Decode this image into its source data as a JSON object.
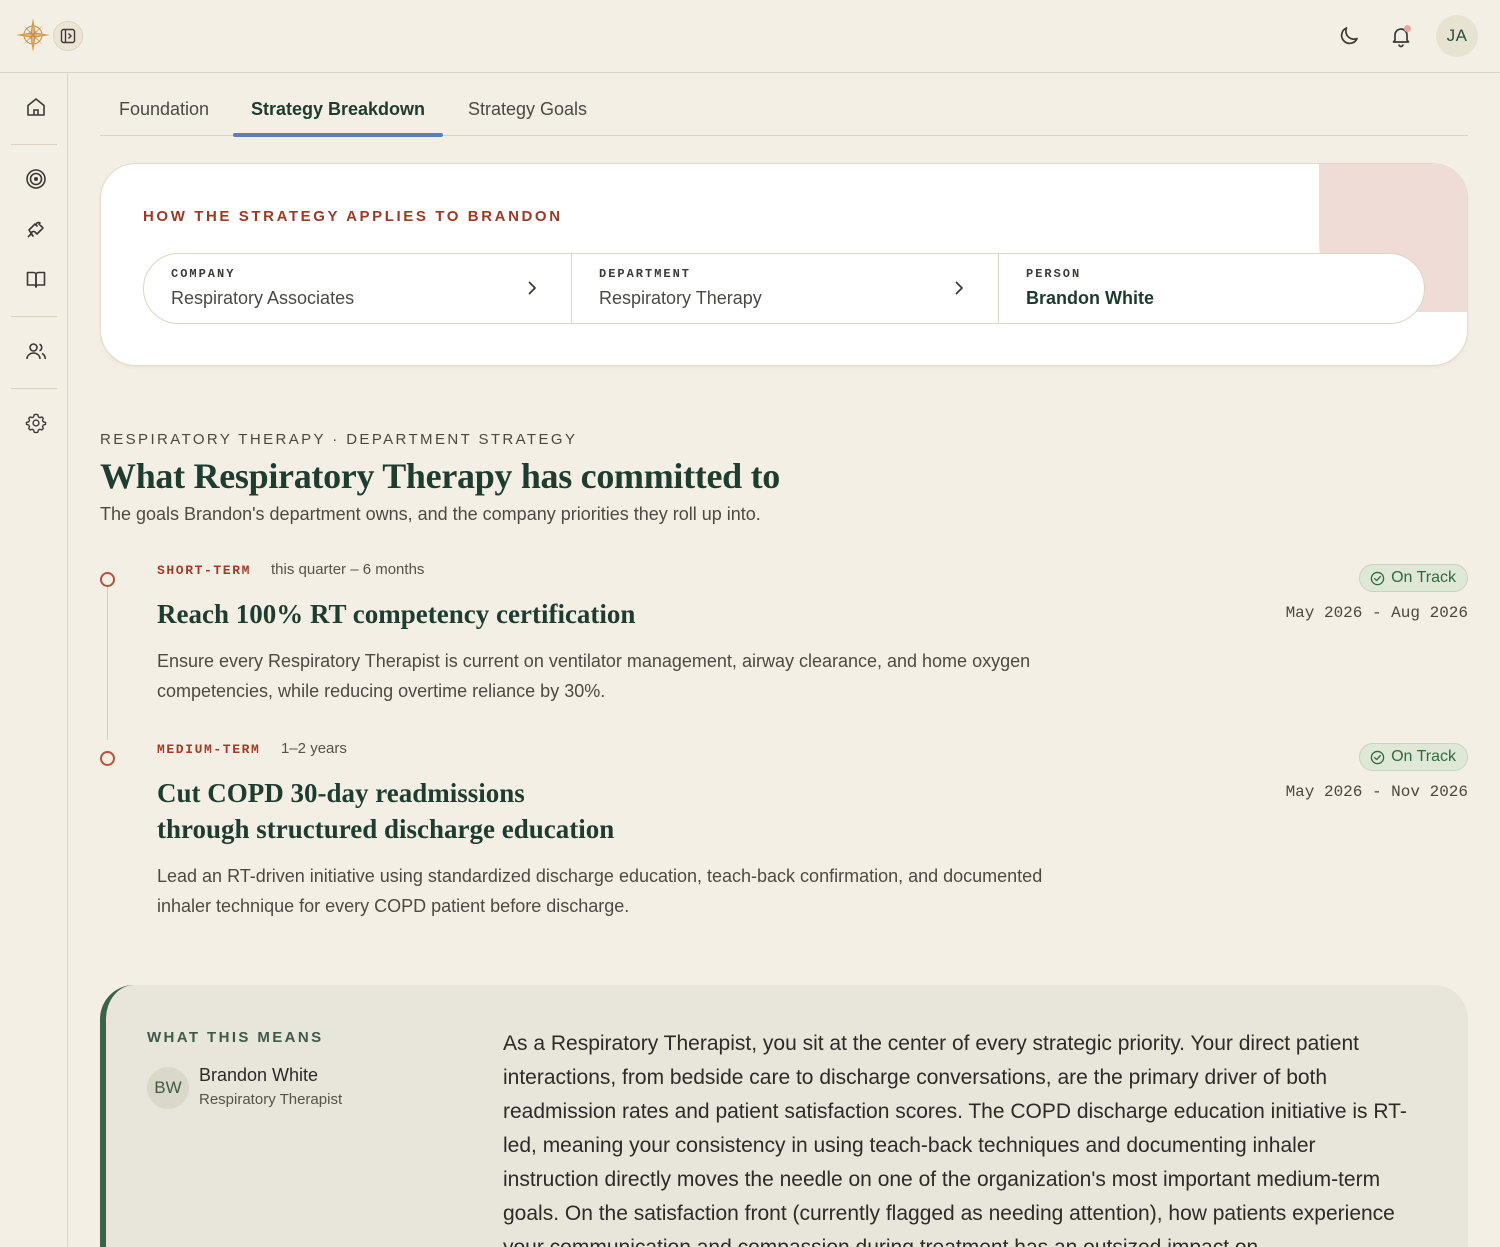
{
  "header": {
    "logo_icon": "compass-star-icon",
    "toggle_icon": "sidebar-toggle-icon",
    "user_initials": "JA",
    "notification_dot_color": "#e8a7a0"
  },
  "rail": {
    "items": [
      {
        "name": "home",
        "icon": "home-icon"
      },
      {
        "name": "goals",
        "icon": "target-icon"
      },
      {
        "name": "strategy",
        "icon": "puzzle-icon"
      },
      {
        "name": "library",
        "icon": "book-icon"
      },
      {
        "name": "people",
        "icon": "users-icon"
      },
      {
        "name": "settings",
        "icon": "gear-icon"
      }
    ]
  },
  "tabs": [
    {
      "label": "Foundation",
      "active": false
    },
    {
      "label": "Strategy Breakdown",
      "active": true
    },
    {
      "label": "Strategy Goals",
      "active": false
    }
  ],
  "applies": {
    "title": "HOW THE STRATEGY APPLIES TO BRANDON",
    "crumbs": [
      {
        "label": "COMPANY",
        "value": "Respiratory Associates"
      },
      {
        "label": "DEPARTMENT",
        "value": "Respiratory Therapy"
      },
      {
        "label": "PERSON",
        "value": "Brandon White"
      }
    ]
  },
  "department": {
    "eyebrow": "RESPIRATORY THERAPY · DEPARTMENT STRATEGY",
    "title": "What Respiratory Therapy has committed to",
    "subtitle": "The goals Brandon's department owns, and the company priorities they roll up into.",
    "goals": [
      {
        "term": "SHORT-TERM",
        "span": "this quarter – 6 months",
        "title_lines": [
          "Reach 100% RT competency certification"
        ],
        "description": "Ensure every Respiratory Therapist is current on ventilator management, airway clearance, and home oxygen competencies, while reducing overtime reliance by 30%.",
        "status": "On Track",
        "dates": "May 2026 - Aug 2026"
      },
      {
        "term": "MEDIUM-TERM",
        "span": "1–2 years",
        "title_lines": [
          "Cut COPD 30-day readmissions",
          "through structured discharge education"
        ],
        "description": "Lead an RT-driven initiative using standardized discharge education, teach-back confirmation, and documented inhaler technique for every COPD patient before discharge.",
        "status": "On Track",
        "dates": "May 2026 - Nov 2026"
      }
    ]
  },
  "meaning": {
    "label": "WHAT THIS MEANS",
    "initials": "BW",
    "name": "Brandon White",
    "role": "Respiratory Therapist",
    "text": "As a Respiratory Therapist, you sit at the center of every strategic priority. Your direct patient interactions, from bedside care to discharge conversations, are the primary driver of both readmission rates and patient satisfaction scores. The COPD discharge education initiative is RT-led, meaning your consistency in using teach-back techniques and documenting inhaler instruction directly moves the needle on one of the organization's most important medium-term goals. On the satisfaction front (currently flagged as needing attention), how patients experience your communication and compassion during treatment has an outsized impact on"
  },
  "colors": {
    "background": "#f4efe4",
    "accent_green": "#1e3c2f",
    "accent_red": "#9b3a24",
    "tab_underline": "#5d7fb0",
    "status_green": "#2f6a3e"
  }
}
